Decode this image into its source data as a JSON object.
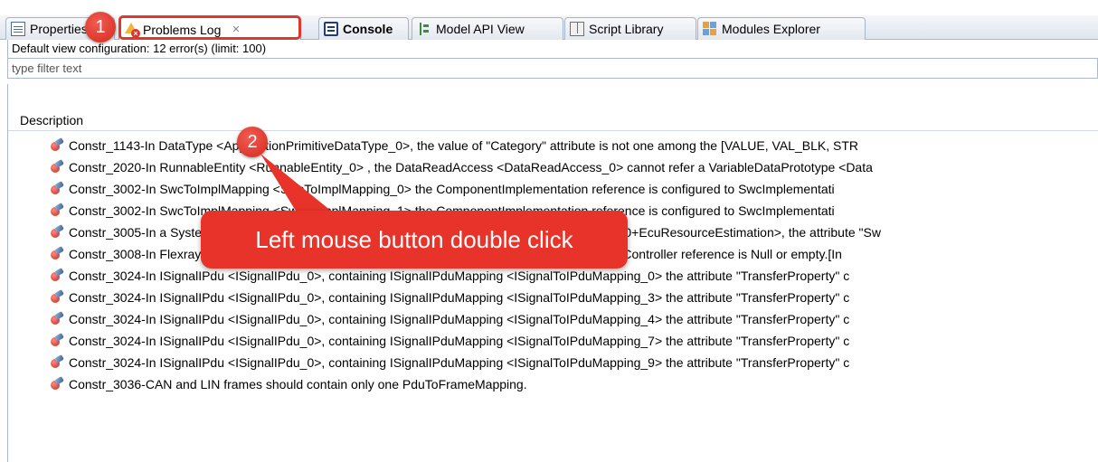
{
  "tabs": [
    {
      "label": "Properties",
      "icon": "properties-icon"
    },
    {
      "label": "Problems Log",
      "icon": "problems-log-icon",
      "active": true,
      "close": "✕"
    },
    {
      "label": "Console",
      "icon": "console-icon",
      "bold": true
    },
    {
      "label": "Model API View",
      "icon": "model-api-icon"
    },
    {
      "label": "Script Library",
      "icon": "script-library-icon"
    },
    {
      "label": "Modules Explorer",
      "icon": "modules-explorer-icon"
    }
  ],
  "status": "Default view configuration: 12 error(s) (limit: 100)",
  "filter": {
    "placeholder": "type filter text",
    "value": ""
  },
  "table": {
    "header": "Description",
    "rows": [
      "Constr_1143-In DataType <ApplicationPrimitiveDataType_0>, the value of \"Category\" attribute is not one among the [VALUE, VAL_BLK, STR",
      "Constr_2020-In RunnableEntity <RunnableEntity_0> , the DataReadAccess <DataReadAccess_0> cannot refer a VariableDataPrototype <Data",
      "Constr_3002-In SwcToImplMapping <SwcToImplMapping_0> the ComponentImplementation reference is configured to SwcImplementati",
      "Constr_3002-In SwcToImplMapping <SwcToImplMapping_1> the ComponentImplementation reference is configured to SwcImplementati",
      "Constr_3005-In a SystemMapping <SystemMapping_0>, EcuResourceMapping <SystemMapping_0+EcuResourceEstimation>, the attribute \"Sw",
      "Constr_3008-In FlexrayCommunicationConnector <FlexrayCommunicationConnector_0>, the  ComController reference is Null or empty.[In",
      "Constr_3024-In ISignalIPdu <ISignalIPdu_0>, containing ISignalIPduMapping <ISignalToIPduMapping_0>  the attribute \"TransferProperty\" c",
      "Constr_3024-In ISignalIPdu <ISignalIPdu_0>, containing ISignalIPduMapping <ISignalToIPduMapping_3>  the attribute \"TransferProperty\" c",
      "Constr_3024-In ISignalIPdu <ISignalIPdu_0>, containing ISignalIPduMapping <ISignalToIPduMapping_4>  the attribute \"TransferProperty\" c",
      "Constr_3024-In ISignalIPdu <ISignalIPdu_0>, containing ISignalIPduMapping <ISignalToIPduMapping_7>  the attribute \"TransferProperty\" c",
      "Constr_3024-In ISignalIPdu <ISignalIPdu_0>, containing ISignalIPduMapping <ISignalToIPduMapping_9>  the attribute \"TransferProperty\" c",
      "Constr_3036-CAN and LIN frames should contain only one PduToFrameMapping."
    ]
  },
  "annotations": {
    "badge_1": "1",
    "badge_2": "2",
    "callout": "Left mouse button double click",
    "accent_color": "#e8332a"
  }
}
